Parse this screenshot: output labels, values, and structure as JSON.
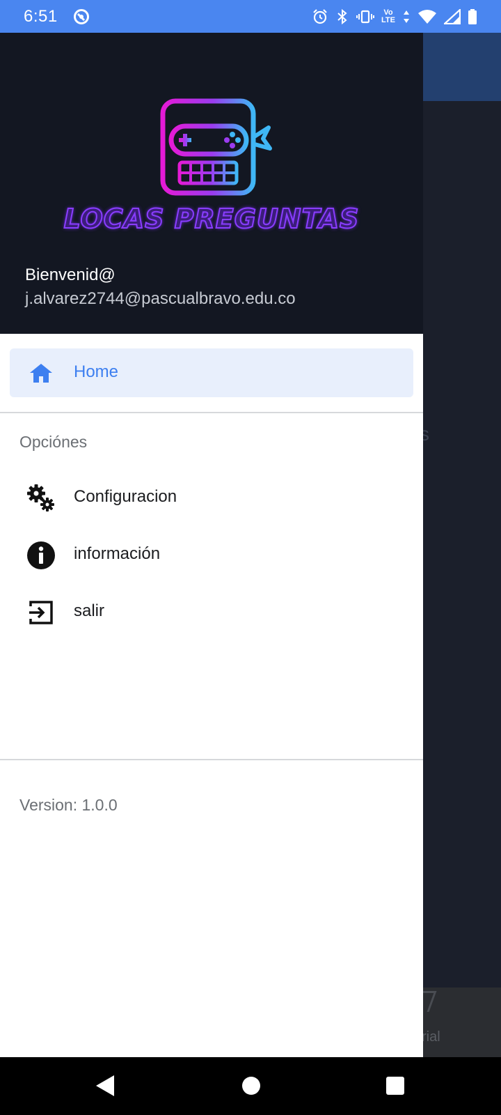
{
  "status_bar": {
    "time": "6:51",
    "lte_top": "Vo",
    "lte_bottom": "LTE"
  },
  "drawer": {
    "app_title": "LOCAS PREGUNTAS",
    "welcome": "Bienvenid@",
    "email": "j.alvarez2744@pascualbravo.edu.co",
    "home_label": "Home",
    "section_label": "Opciónes",
    "items": [
      {
        "label": "Configuracion",
        "icon": "gears-icon"
      },
      {
        "label": "información",
        "icon": "info-icon"
      },
      {
        "label": "salir",
        "icon": "exit-icon"
      }
    ],
    "version": "Version: 1.0.0"
  },
  "background": {
    "partial_text": "s",
    "bottom_partial_label": "rial"
  },
  "colors": {
    "status_bar": "#4a86f0",
    "drawer_header": "#131722",
    "accent": "#3d7ff0",
    "selected_bg": "#e8effc"
  }
}
